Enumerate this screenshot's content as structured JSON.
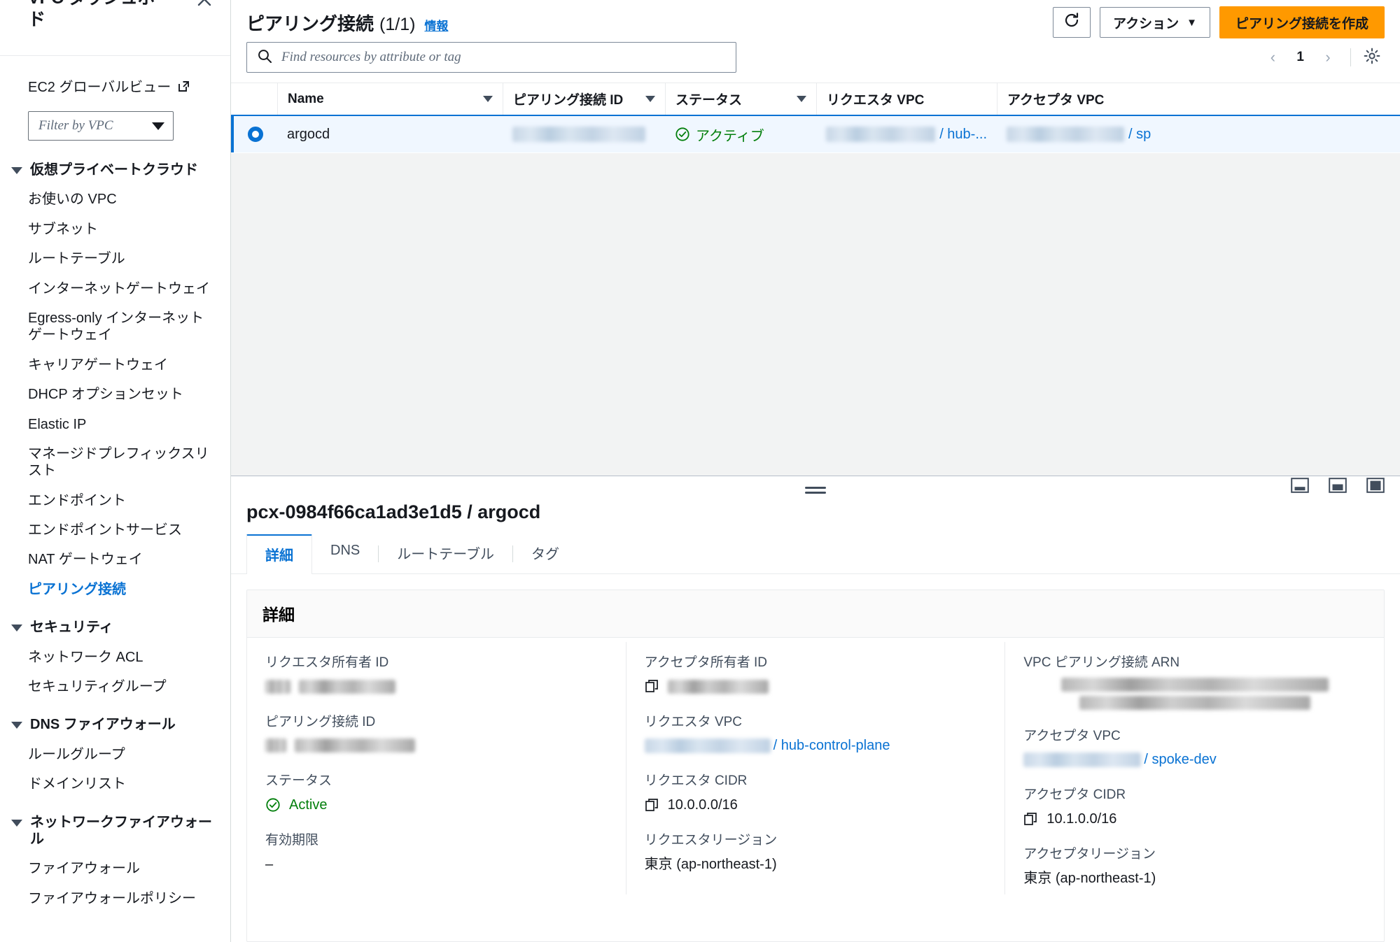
{
  "sidebar": {
    "title": "VPC ダッシュボード",
    "close_label": "×",
    "global_view": "EC2 グローバルビュー",
    "filter_placeholder": "Filter by VPC",
    "groups": [
      {
        "label": "仮想プライベートクラウド",
        "items": [
          "お使いの VPC",
          "サブネット",
          "ルートテーブル",
          "インターネットゲートウェイ",
          "Egress-only インターネットゲートウェイ",
          "キャリアゲートウェイ",
          "DHCP オプションセット",
          "Elastic IP",
          "マネージドプレフィックスリスト",
          "エンドポイント",
          "エンドポイントサービス",
          "NAT ゲートウェイ",
          "ピアリング接続"
        ],
        "active": "ピアリング接続"
      },
      {
        "label": "セキュリティ",
        "items": [
          "ネットワーク ACL",
          "セキュリティグループ"
        ],
        "active": ""
      },
      {
        "label": "DNS ファイアウォール",
        "items": [
          "ルールグループ",
          "ドメインリスト"
        ],
        "active": ""
      },
      {
        "label": "ネットワークファイアウォール",
        "items": [
          "ファイアウォール",
          "ファイアウォールポリシー"
        ],
        "active": ""
      }
    ]
  },
  "header": {
    "title": "ピアリング接続",
    "count": "(1/1)",
    "info_link": "情報",
    "refresh_icon": "refresh-icon",
    "actions_label": "アクション",
    "actions_caret": "▼",
    "create_label": "ピアリング接続を作成"
  },
  "search": {
    "placeholder": "Find resources by attribute or tag",
    "value": ""
  },
  "pagination": {
    "prev": "‹",
    "page": "1",
    "next": "›",
    "settings_icon": "gear-icon"
  },
  "table": {
    "columns": [
      "Name",
      "ピアリング接続 ID",
      "ステータス",
      "リクエスタ VPC",
      "アクセプタ VPC"
    ],
    "rows": [
      {
        "selected": true,
        "name": "argocd",
        "peering_id": "",
        "status": "アクティブ",
        "requester_vpc_suffix": "/ hub-...",
        "accepter_vpc_suffix": "/ sp"
      }
    ]
  },
  "split_panel": {
    "title": "pcx-0984f66ca1ad3e1d5 / argocd",
    "tabs": [
      "詳細",
      "DNS",
      "ルートテーブル",
      "タグ"
    ],
    "selected_tab": "詳細",
    "card_title": "詳細",
    "columns": [
      {
        "fields": [
          {
            "label": "リクエスタ所有者 ID",
            "value": "",
            "redacted": true,
            "copy": false
          },
          {
            "label": "ピアリング接続 ID",
            "value": "",
            "redacted": true,
            "copy": false
          },
          {
            "label": "ステータス",
            "value": "Active",
            "redacted": false,
            "copy": false,
            "status": true
          },
          {
            "label": "有効期限",
            "value": "–",
            "redacted": false,
            "copy": false
          }
        ]
      },
      {
        "fields": [
          {
            "label": "アクセプタ所有者 ID",
            "value": "",
            "redacted": true,
            "copy": true
          },
          {
            "label": "リクエスタ VPC",
            "value": "/ hub-control-plane",
            "redacted": true,
            "copy": false,
            "link": true
          },
          {
            "label": "リクエスタ CIDR",
            "value": "10.0.0.0/16",
            "redacted": false,
            "copy": true
          },
          {
            "label": "リクエスタリージョン",
            "value": "東京 (ap-northeast-1)",
            "redacted": false,
            "copy": false
          }
        ]
      },
      {
        "fields": [
          {
            "label": "VPC ピアリング接続 ARN",
            "value": "",
            "redacted": true,
            "copy": false,
            "multiline": true
          },
          {
            "label": "アクセプタ VPC",
            "value": "/ spoke-dev",
            "redacted": true,
            "copy": false,
            "link": true
          },
          {
            "label": "アクセプタ CIDR",
            "value": "10.1.0.0/16",
            "redacted": false,
            "copy": true
          },
          {
            "label": "アクセプタリージョン",
            "value": "東京 (ap-northeast-1)",
            "redacted": false,
            "copy": false
          }
        ]
      }
    ],
    "panel_controls": [
      "panel-bottom-icon",
      "panel-center-icon",
      "panel-full-icon"
    ]
  },
  "colors": {
    "accent_blue": "#0972d3",
    "accent_orange": "#ff9900",
    "status_green": "#037f0c",
    "selected_row_bg": "#f0f7ff",
    "empty_bg": "#f2f3f3"
  }
}
